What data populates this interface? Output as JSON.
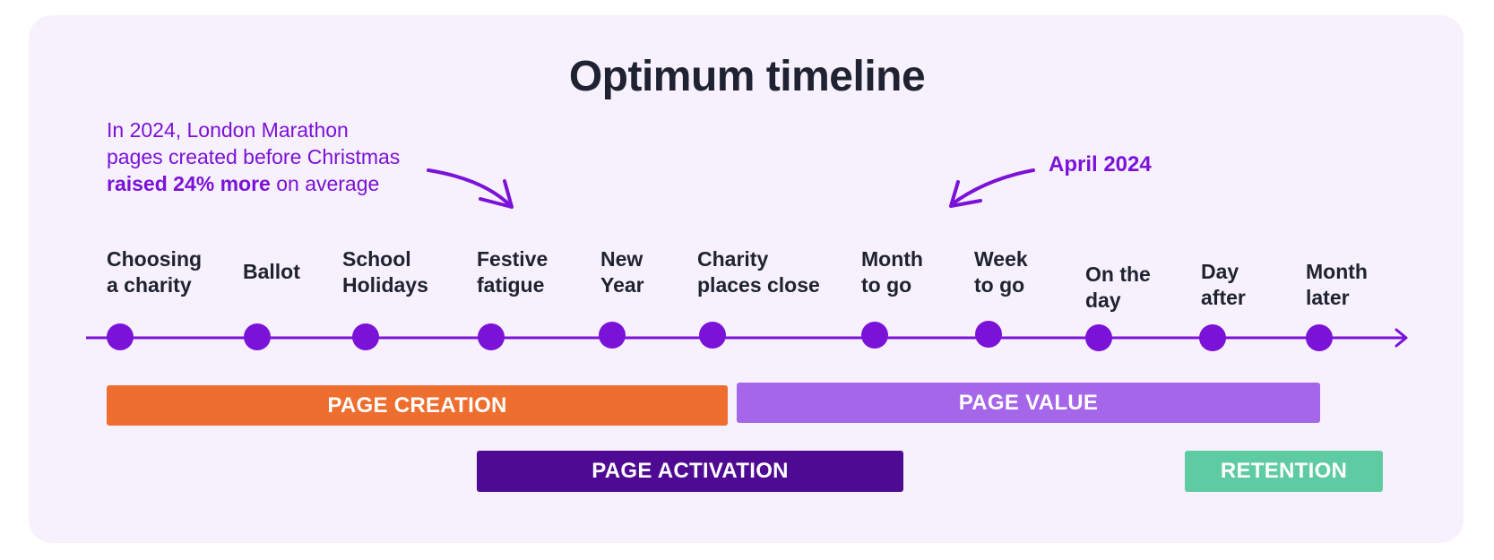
{
  "title": "Optimum timeline",
  "annotation": {
    "prefix": "In 2024, London Marathon pages created before Christmas ",
    "bold1": "raised 24% more",
    "suffix": " on average"
  },
  "april_label": "April 2024",
  "colors": {
    "background_card": "#f7f0fd",
    "accent_purple": "#7b12d8",
    "text_dark": "#1f2230",
    "page_creation": "#ee6e2f",
    "page_value": "#a666ea",
    "page_activation": "#4f0a93",
    "retention": "#5ecba3"
  },
  "milestones": [
    {
      "line1": "Choosing",
      "line2": "a charity"
    },
    {
      "line1": "Ballot",
      "line2": ""
    },
    {
      "line1": "School",
      "line2": "Holidays"
    },
    {
      "line1": "Festive",
      "line2": "fatigue"
    },
    {
      "line1": "New",
      "line2": "Year"
    },
    {
      "line1": "Charity",
      "line2": "places close"
    },
    {
      "line1": "Month",
      "line2": "to go"
    },
    {
      "line1": "Week",
      "line2": "to go"
    },
    {
      "line1": "On the",
      "line2": "day"
    },
    {
      "line1": "Day",
      "line2": "after"
    },
    {
      "line1": "Month",
      "line2": "later"
    }
  ],
  "phases": [
    {
      "label": "PAGE CREATION",
      "start_milestone": "Choosing a charity",
      "end_milestone": "Charity places close"
    },
    {
      "label": "PAGE VALUE",
      "start_milestone": "Charity places close",
      "end_milestone": "Month later"
    },
    {
      "label": "PAGE ACTIVATION",
      "start_milestone": "Festive fatigue",
      "end_milestone": "Month to go"
    },
    {
      "label": "RETENTION",
      "start_milestone": "Day after",
      "end_milestone": "Month later"
    }
  ]
}
